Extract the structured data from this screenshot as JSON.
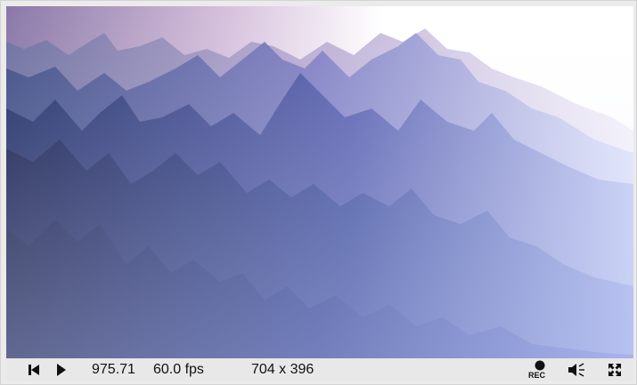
{
  "viewer": {
    "time": "975.71",
    "fps": "60.0 fps",
    "resolution": "704 x 396",
    "rec_label": "REC"
  },
  "icons": {
    "rewind": "skip-to-start-icon",
    "play": "play-icon",
    "record": "record-icon",
    "volume": "volume-icon",
    "fullscreen": "fullscreen-icon"
  },
  "colors": {
    "sky_highlight": "#ffffff",
    "sky_purple": "#c9a9d6",
    "mountain_dark": "#111a4a",
    "mountain_mid": "#3f4f9e",
    "haze": "#b8c2ee"
  }
}
